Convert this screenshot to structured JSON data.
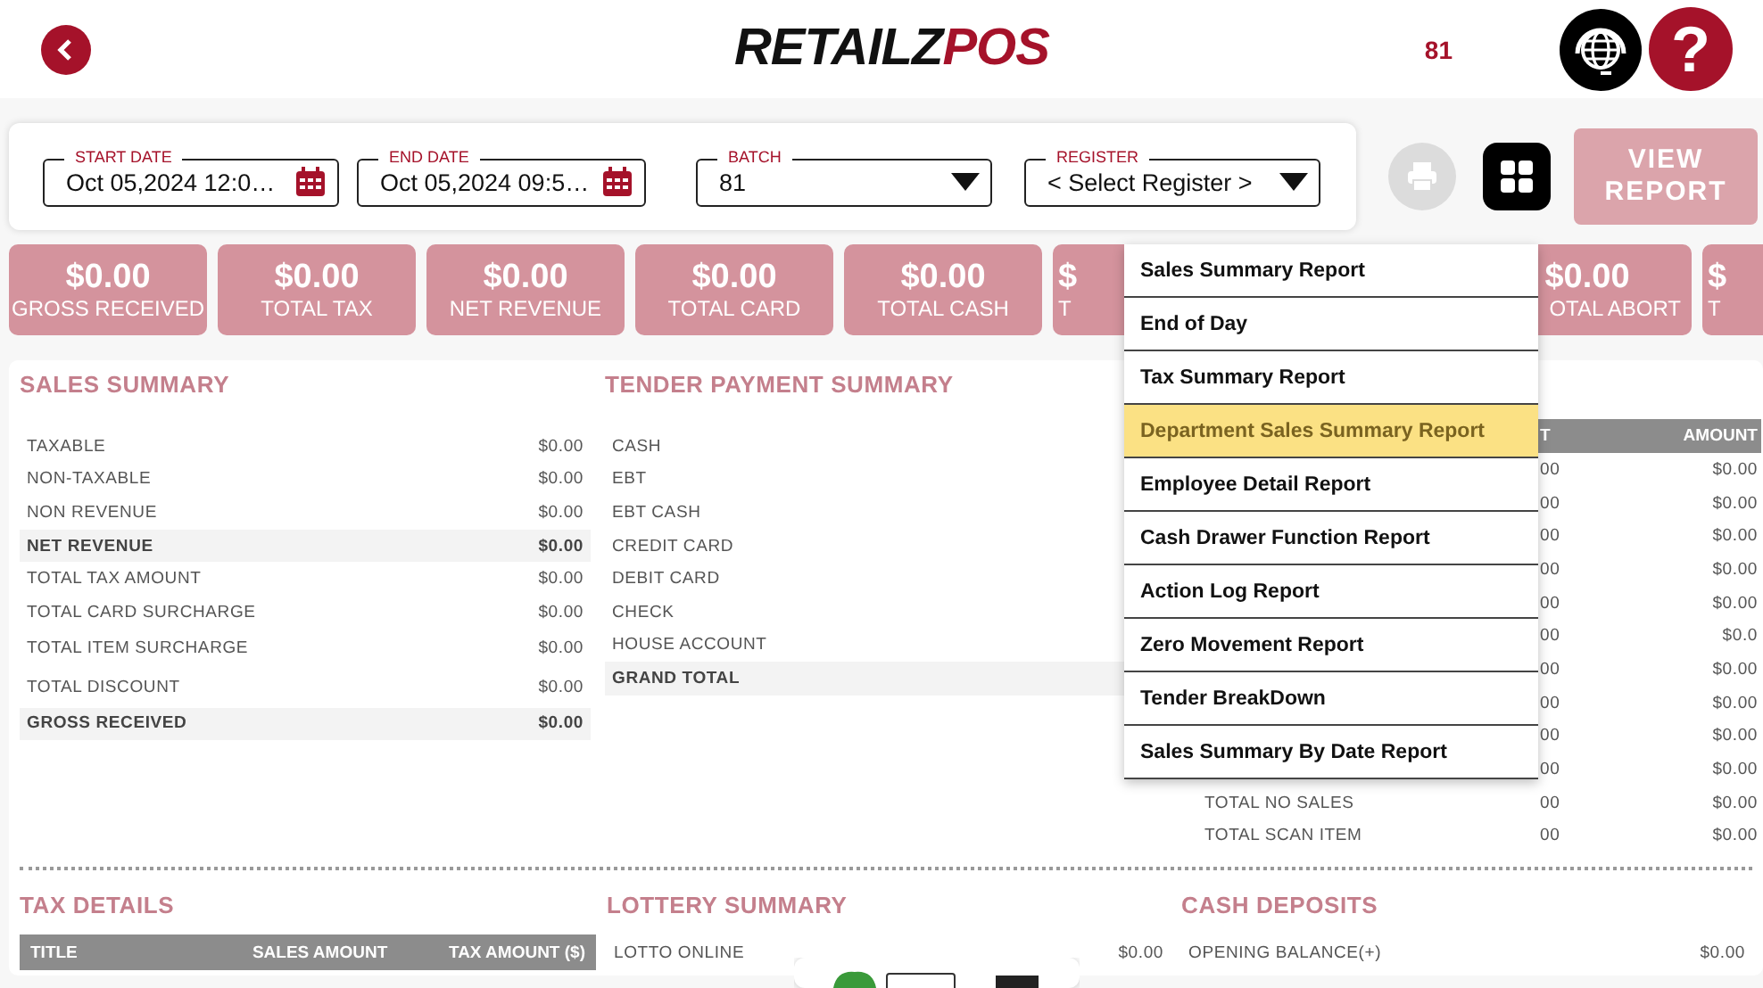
{
  "header": {
    "logo": {
      "part_1": "RETAILZ",
      "part_2": "POS"
    },
    "batch_number": "81",
    "help_glyph": "?"
  },
  "filters": [
    {
      "label": "START DATE",
      "value": "Oct 05,2024 12:0…",
      "kind": "date"
    },
    {
      "label": "END DATE",
      "value": "Oct 05,2024 09:5…",
      "kind": "date"
    },
    {
      "label": "BATCH",
      "value": "81",
      "kind": "select"
    },
    {
      "label": "REGISTER",
      "value": "< Select Register >",
      "kind": "select"
    }
  ],
  "actions": {
    "print_disabled": true,
    "view_report": {
      "label": "VIEW REPORT",
      "disabled": true
    }
  },
  "summary_cards": [
    {
      "value": "$0.00",
      "label": "GROSS RECEIVED",
      "kind": "full"
    },
    {
      "value": "$0.00",
      "label": "TOTAL TAX",
      "kind": "full"
    },
    {
      "value": "$0.00",
      "label": "NET REVENUE",
      "kind": "full"
    },
    {
      "value": "$0.00",
      "label": "TOTAL CARD",
      "kind": "full"
    },
    {
      "value": "$0.00",
      "label": "TOTAL CASH",
      "kind": "full"
    },
    {
      "value": "$",
      "label": "T",
      "kind": "partial"
    },
    {
      "value": "$0.00",
      "label": "OTAL ABORT",
      "kind": "full"
    },
    {
      "value": "$",
      "label": "T",
      "kind": "partial"
    }
  ],
  "sales_summary": {
    "title": "SALES SUMMARY",
    "rows": [
      {
        "label": "TAXABLE",
        "value": "$0.00",
        "highlighted": false
      },
      {
        "label": "NON-TAXABLE",
        "value": "$0.00",
        "highlighted": false
      },
      {
        "label": "NON REVENUE",
        "value": "$0.00",
        "highlighted": false
      },
      {
        "label": "NET REVENUE",
        "value": "$0.00",
        "highlighted": true
      },
      {
        "label": "TOTAL TAX AMOUNT",
        "value": "$0.00",
        "highlighted": false
      },
      {
        "label": "TOTAL CARD SURCHARGE",
        "value": "$0.00",
        "highlighted": false
      },
      {
        "label": "TOTAL ITEM SURCHARGE",
        "value": "$0.00",
        "highlighted": false
      },
      {
        "label": "TOTAL DISCOUNT",
        "value": "$0.00",
        "highlighted": false
      },
      {
        "label": "GROSS RECEIVED",
        "value": "$0.00",
        "highlighted": true
      }
    ]
  },
  "tender_payment_summary": {
    "title": "TENDER PAYMENT SUMMARY",
    "rows": [
      {
        "label": "CASH",
        "highlighted": false
      },
      {
        "label": "EBT",
        "highlighted": false
      },
      {
        "label": "EBT CASH",
        "highlighted": false
      },
      {
        "label": "CREDIT CARD",
        "highlighted": false
      },
      {
        "label": "DEBIT CARD",
        "highlighted": false
      },
      {
        "label": "CHECK",
        "highlighted": false
      },
      {
        "label": "HOUSE ACCOUNT",
        "highlighted": false
      },
      {
        "label": "GRAND TOTAL",
        "highlighted": true
      }
    ]
  },
  "section_3": {
    "columns": [
      "T",
      "AMOUNT"
    ],
    "rows": [
      {
        "count": "00",
        "amount": "$0.00"
      },
      {
        "count": "00",
        "amount": "$0.00"
      },
      {
        "count": "00",
        "amount": "$0.00"
      },
      {
        "count": "00",
        "amount": "$0.00"
      },
      {
        "count": "00",
        "amount": "$0.00"
      },
      {
        "count": "00",
        "amount": "$0.0"
      },
      {
        "count": "00",
        "amount": "$0.00"
      },
      {
        "count": "00",
        "amount": "$0.00"
      },
      {
        "count": "00",
        "amount": "$0.00"
      },
      {
        "count": "00",
        "amount": "$0.00"
      },
      {
        "label": "TOTAL NO SALES",
        "count": "00",
        "amount": "$0.00"
      },
      {
        "label": "TOTAL SCAN ITEM",
        "count": "00",
        "amount": "$0.00"
      }
    ]
  },
  "report_menu": {
    "items": [
      {
        "label": "Sales Summary Report",
        "selected": false
      },
      {
        "label": "End of Day",
        "selected": false
      },
      {
        "label": "Tax Summary Report",
        "selected": false
      },
      {
        "label": "Department Sales Summary Report",
        "selected": true
      },
      {
        "label": "Employee Detail Report",
        "selected": false
      },
      {
        "label": "Cash Drawer Function Report",
        "selected": false
      },
      {
        "label": "Action Log Report",
        "selected": false
      },
      {
        "label": "Zero Movement Report",
        "selected": false
      },
      {
        "label": "Tender BreakDown",
        "selected": false
      },
      {
        "label": "Sales Summary By Date Report",
        "selected": false
      }
    ]
  },
  "tax_details": {
    "title": "TAX DETAILS",
    "columns": [
      "TITLE",
      "SALES AMOUNT",
      "TAX AMOUNT ($)"
    ]
  },
  "lottery_summary": {
    "title": "LOTTERY SUMMARY",
    "rows": [
      {
        "label": "LOTTO ONLINE",
        "value": "$0.00"
      }
    ]
  },
  "cash_deposits": {
    "title": "CASH DEPOSITS",
    "rows": [
      {
        "label": "OPENING BALANCE(+)",
        "value": "$0.00"
      }
    ]
  }
}
